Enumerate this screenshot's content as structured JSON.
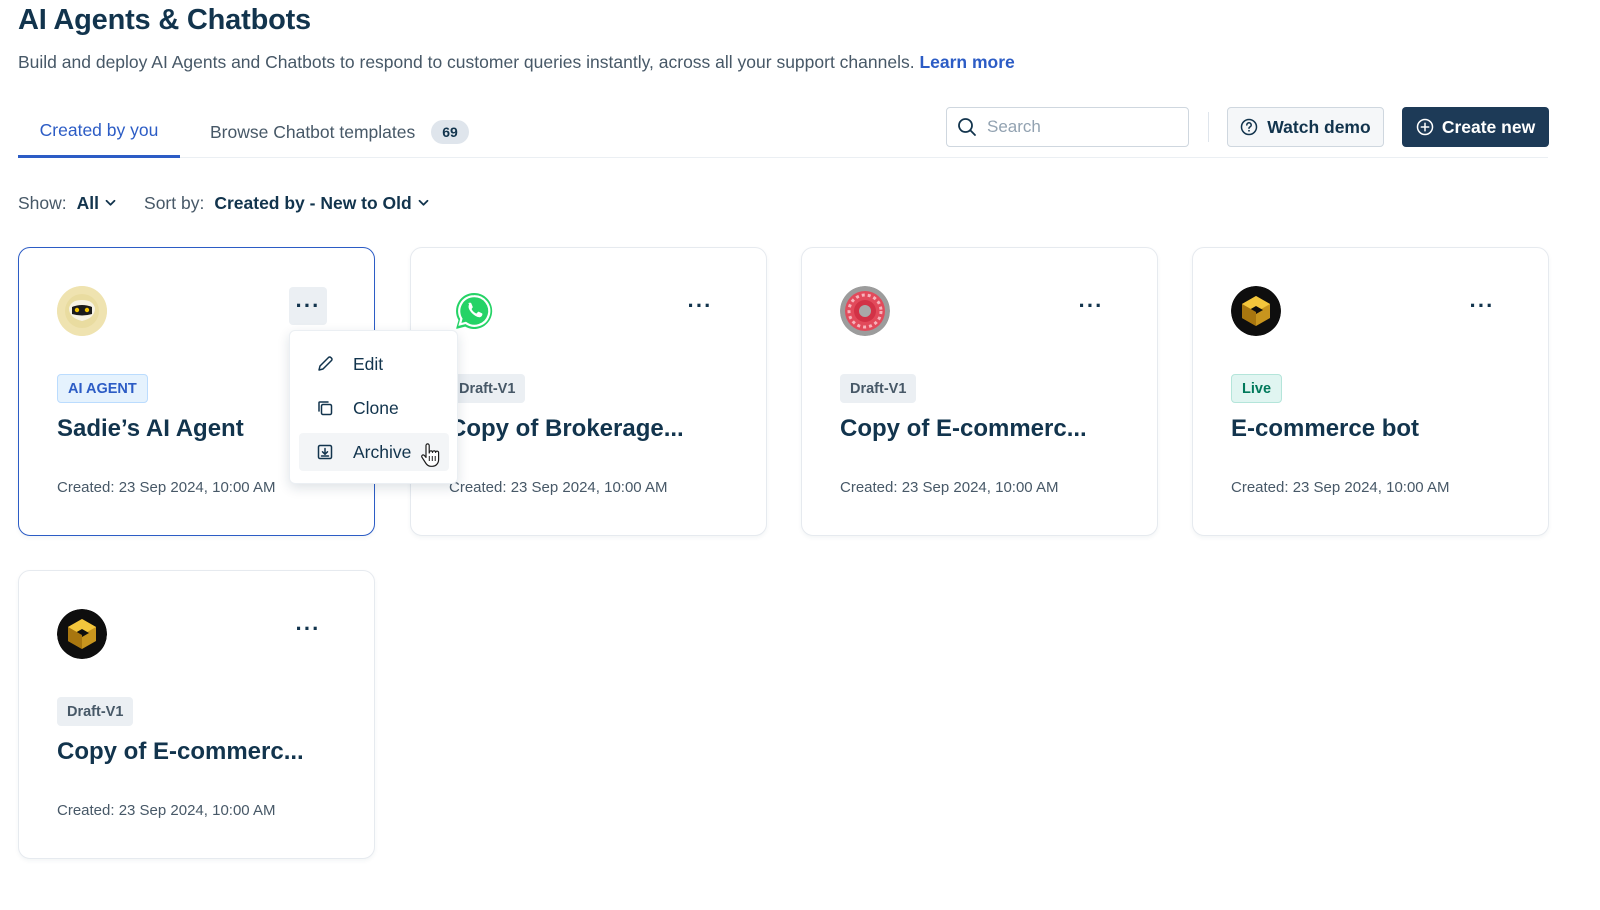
{
  "header": {
    "title": "AI Agents & Chatbots",
    "description": "Build and deploy AI Agents and Chatbots to respond to customer queries instantly, across all your support channels.",
    "learn_more": "Learn more"
  },
  "tabs": {
    "created_by_you": "Created by you",
    "browse_templates": "Browse Chatbot templates",
    "templates_count": "69"
  },
  "toolbar": {
    "search_placeholder": "Search",
    "watch_demo": "Watch demo",
    "create_new": "Create new"
  },
  "filters": {
    "show_label": "Show:",
    "show_value": "All",
    "sort_label": "Sort by:",
    "sort_value": "Created by - New to Old"
  },
  "cards": [
    {
      "avatar": "robot-icon",
      "badge": "AI AGENT",
      "badge_type": "ai",
      "title": "Sadie’s AI Agent",
      "created": "Created: 23 Sep 2024, 10:00 AM",
      "more": "···"
    },
    {
      "avatar": "whatsapp-icon",
      "badge": "Draft-V1",
      "badge_type": "draft",
      "title": "Copy of Brokerage...",
      "created": "Created: 23 Sep 2024, 10:00 AM",
      "more": "···"
    },
    {
      "avatar": "red-swirl-icon",
      "badge": "Draft-V1",
      "badge_type": "draft",
      "title": "Copy of E-commerc...",
      "created": "Created: 23 Sep 2024, 10:00 AM",
      "more": "···"
    },
    {
      "avatar": "gold-cube-icon",
      "badge": "Live",
      "badge_type": "live",
      "title": "E-commerce bot",
      "created": "Created: 23 Sep 2024, 10:00 AM",
      "more": "···"
    },
    {
      "avatar": "gold-cube-icon",
      "badge": "Draft-V1",
      "badge_type": "draft",
      "title": "Copy of E-commerc...",
      "created": "Created: 23 Sep 2024, 10:00 AM",
      "more": "···"
    }
  ],
  "context_menu": {
    "edit": "Edit",
    "clone": "Clone",
    "archive": "Archive"
  },
  "colors": {
    "primary": "#1d3a57",
    "link": "#2c5cc5",
    "text": "#12344d",
    "live_badge": "#00795b"
  }
}
